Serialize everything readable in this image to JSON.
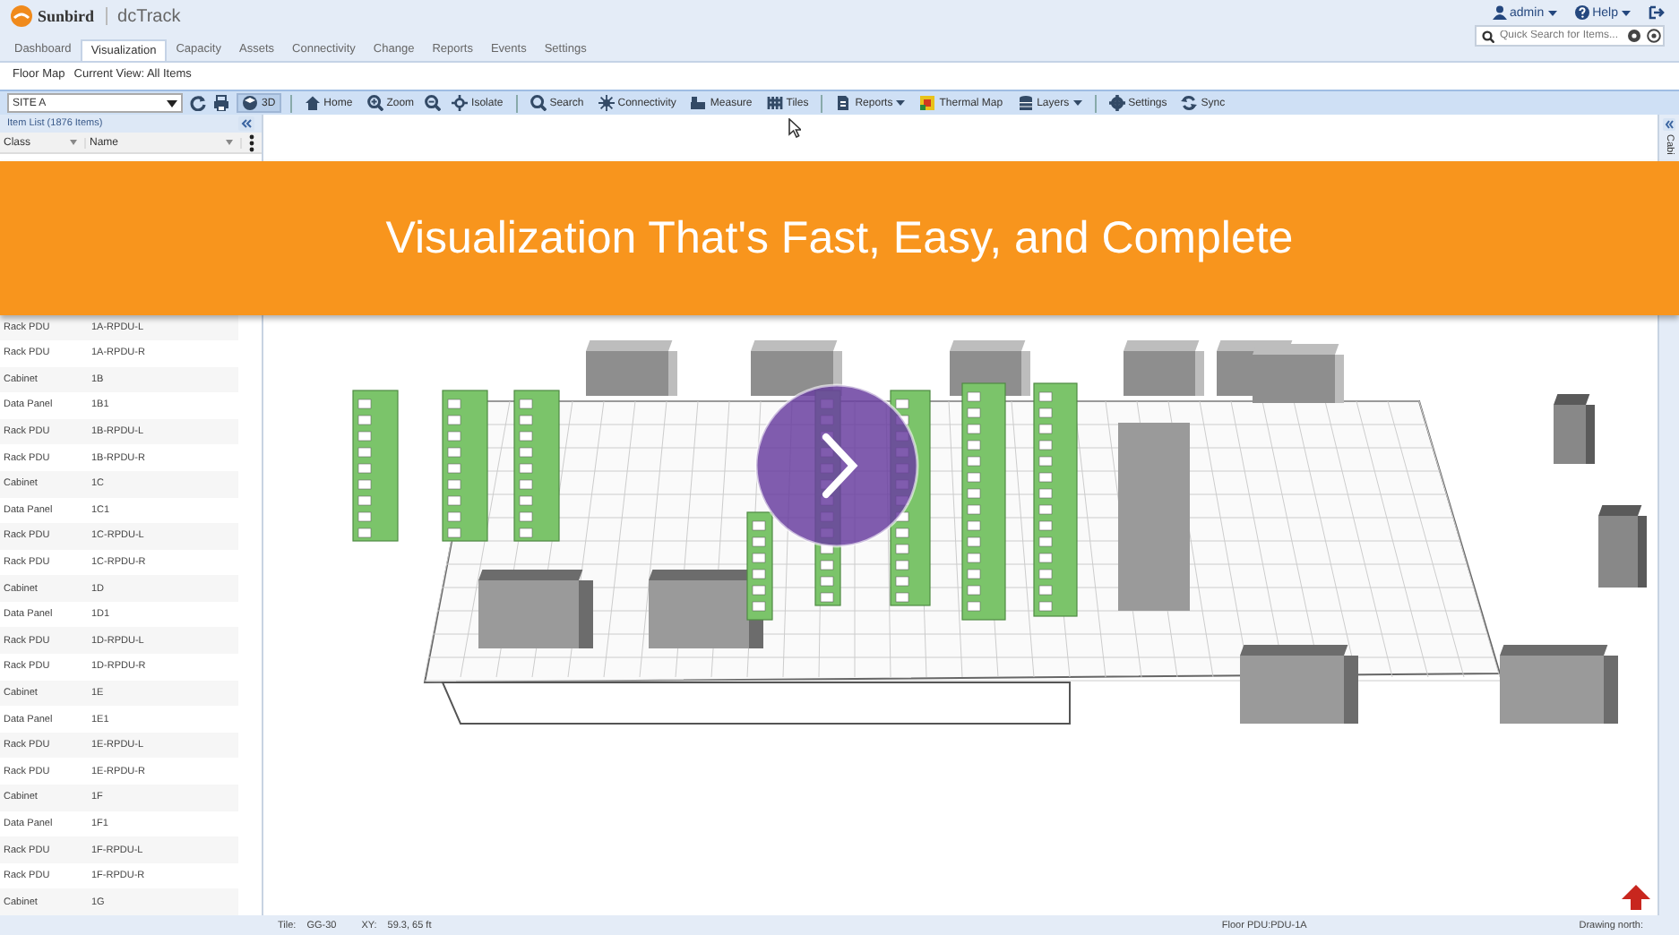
{
  "header": {
    "brand": "Sunbird",
    "product": "dcTrack",
    "user": "admin",
    "help": "Help"
  },
  "quick_search": {
    "placeholder": "Quick Search for Items..."
  },
  "tabs": [
    {
      "label": "Dashboard",
      "selected": false
    },
    {
      "label": "Visualization",
      "selected": true
    },
    {
      "label": "Capacity",
      "selected": false
    },
    {
      "label": "Assets",
      "selected": false
    },
    {
      "label": "Connectivity",
      "selected": false
    },
    {
      "label": "Change",
      "selected": false
    },
    {
      "label": "Reports",
      "selected": false
    },
    {
      "label": "Events",
      "selected": false
    },
    {
      "label": "Settings",
      "selected": false
    }
  ],
  "breadcrumb": [
    "Floor Map",
    "Current View: All Items"
  ],
  "toolbar": {
    "site": "SITE A",
    "items": [
      {
        "label": "3D",
        "pressed": true,
        "menu": false
      },
      {
        "label": "Home",
        "pressed": false,
        "menu": false
      },
      {
        "label": "Zoom",
        "pressed": false,
        "menu": false
      },
      {
        "label": "Isolate",
        "pressed": false,
        "menu": false
      },
      {
        "label": "Search",
        "pressed": false,
        "menu": false
      },
      {
        "label": "Connectivity",
        "pressed": false,
        "menu": false
      },
      {
        "label": "Measure",
        "pressed": false,
        "menu": false
      },
      {
        "label": "Tiles",
        "pressed": false,
        "menu": false
      },
      {
        "label": "Reports",
        "pressed": false,
        "menu": true
      },
      {
        "label": "Thermal Map",
        "pressed": false,
        "menu": false
      },
      {
        "label": "Layers",
        "pressed": false,
        "menu": true
      },
      {
        "label": "Settings",
        "pressed": false,
        "menu": false
      },
      {
        "label": "Sync",
        "pressed": false,
        "menu": false
      }
    ]
  },
  "item_list": {
    "title": "Item List (1876 Items)",
    "columns": [
      "Class",
      "Name"
    ],
    "rows": [
      [
        "Rack PDU",
        "1A-RPDU-L"
      ],
      [
        "Rack PDU",
        "1A-RPDU-R"
      ],
      [
        "Cabinet",
        "1B"
      ],
      [
        "Data Panel",
        "1B1"
      ],
      [
        "Rack PDU",
        "1B-RPDU-L"
      ],
      [
        "Rack PDU",
        "1B-RPDU-R"
      ],
      [
        "Cabinet",
        "1C"
      ],
      [
        "Data Panel",
        "1C1"
      ],
      [
        "Rack PDU",
        "1C-RPDU-L"
      ],
      [
        "Rack PDU",
        "1C-RPDU-R"
      ],
      [
        "Cabinet",
        "1D"
      ],
      [
        "Data Panel",
        "1D1"
      ],
      [
        "Rack PDU",
        "1D-RPDU-L"
      ],
      [
        "Rack PDU",
        "1D-RPDU-R"
      ],
      [
        "Cabinet",
        "1E"
      ],
      [
        "Data Panel",
        "1E1"
      ],
      [
        "Rack PDU",
        "1E-RPDU-L"
      ],
      [
        "Rack PDU",
        "1E-RPDU-R"
      ],
      [
        "Cabinet",
        "1F"
      ],
      [
        "Data Panel",
        "1F1"
      ],
      [
        "Rack PDU",
        "1F-RPDU-L"
      ],
      [
        "Rack PDU",
        "1F-RPDU-R"
      ],
      [
        "Cabinet",
        "1G"
      ]
    ]
  },
  "side_panel": {
    "label": "Cabi"
  },
  "banner": {
    "text": "Visualization That's Fast, Easy, and Complete"
  },
  "status_bar": {
    "tile_label": "Tile:",
    "tile": "GG-30",
    "xy_label": "XY:",
    "xy": "59.3, 65 ft",
    "floor_pdu": "Floor PDU:PDU-1A",
    "drawing_north": "Drawing north:"
  }
}
